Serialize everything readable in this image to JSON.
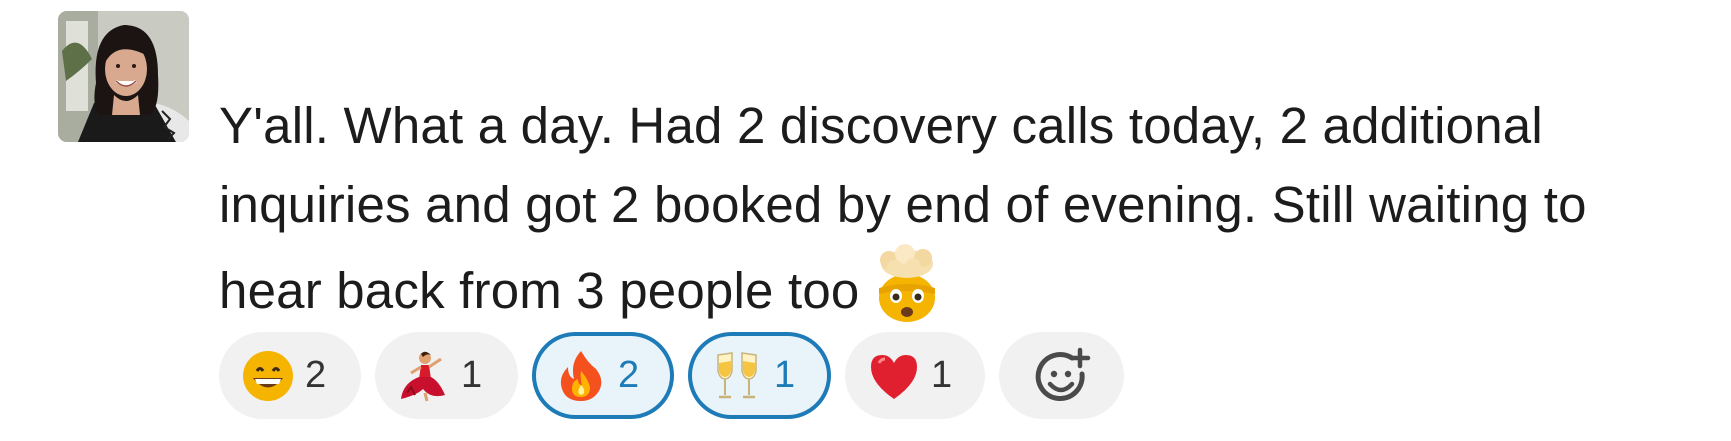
{
  "message": {
    "avatar_icon": "user-avatar-photo",
    "text_lines": [
      "Y'all. What a day. Had 2 discovery calls today, 2 additional",
      "inquiries and got 2 booked by end of evening. Still waiting to",
      "hear back from 3 people too"
    ],
    "inline_emoji": "exploding-head-icon"
  },
  "reactions": [
    {
      "icon": "grinning-face-icon",
      "count": "2",
      "selected": false
    },
    {
      "icon": "dancer-icon",
      "count": "1",
      "selected": false
    },
    {
      "icon": "fire-icon",
      "count": "2",
      "selected": true
    },
    {
      "icon": "clinking-glasses-icon",
      "count": "1",
      "selected": true
    },
    {
      "icon": "red-heart-icon",
      "count": "1",
      "selected": false
    }
  ],
  "add_reaction_icon": "add-reaction-icon",
  "colors": {
    "selected_border": "#1d7bb8",
    "selected_bg": "#e9f3fa",
    "pill_bg": "#f1f1f1",
    "text": "#1d1c1d"
  }
}
